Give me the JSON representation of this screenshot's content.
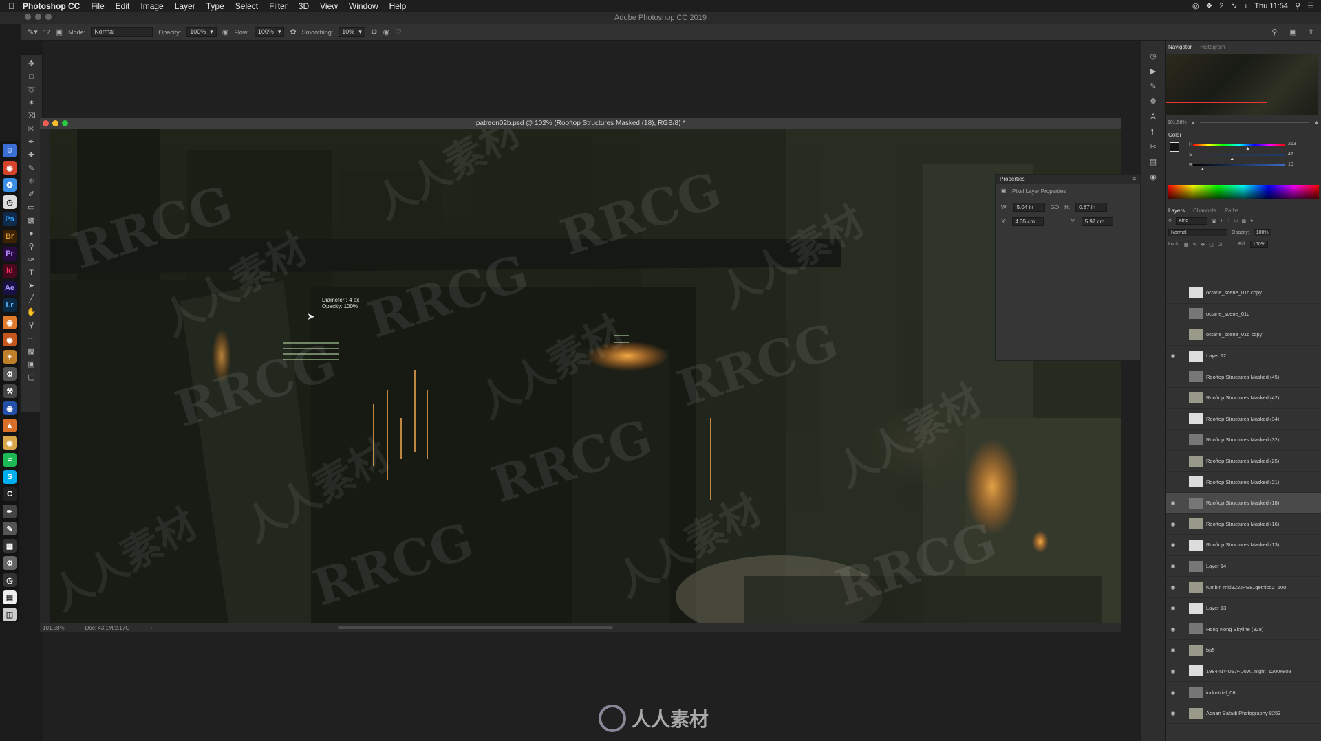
{
  "menubar": {
    "app_name": "Photoshop CC",
    "items": [
      "File",
      "Edit",
      "Image",
      "Layer",
      "Type",
      "Select",
      "Filter",
      "3D",
      "View",
      "Window",
      "Help"
    ],
    "clock": "Thu 11:54",
    "status_badge": "2"
  },
  "window_title": "Adobe Photoshop CC 2019",
  "options_bar": {
    "brush_size": "17",
    "mode_label": "Mode:",
    "mode_value": "Normal",
    "opacity_label": "Opacity:",
    "opacity_value": "100%",
    "flow_label": "Flow:",
    "flow_value": "100%",
    "smoothing_label": "Smoothing:",
    "smoothing_value": "10%"
  },
  "document": {
    "title": "patreon02b.psd @ 102% (Rooftop Structures Masked (18), RGB/8) *",
    "zoom": "101.58%",
    "doc_size": "Doc: 43.1M/2.17G"
  },
  "brush_tooltip": {
    "diameter": "Diameter :  4 px",
    "opacity": "Opacity: 100%"
  },
  "properties": {
    "title": "Properties",
    "subtitle": "Pixel Layer Properties",
    "w_label": "W:",
    "w_value": "5.04 in",
    "link_label": "GO",
    "h_label": "H:",
    "h_value": "0.87 in",
    "x_label": "X:",
    "x_value": "4.35 cm",
    "y_label": "Y:",
    "y_value": "5.97 cm"
  },
  "navigator": {
    "tabs": [
      "Navigator",
      "Histogram"
    ],
    "zoom": "101.58%"
  },
  "color": {
    "title": "Color",
    "h_label": "H",
    "h_value": "213",
    "s_label": "S",
    "s_value": "42",
    "b_label": "B",
    "b_value": "10",
    "h_fraction": 0.59,
    "s_fraction": 0.42,
    "b_fraction": 0.1
  },
  "layers_panel": {
    "tabs": [
      "Layers",
      "Channels",
      "Paths"
    ],
    "filter_label": "Kind",
    "blend_mode": "Normal",
    "opacity_label": "Opacity:",
    "opacity_value": "100%",
    "lock_label": "Lock:",
    "fill_label": "Fill:",
    "fill_value": "100%",
    "layers": [
      {
        "name": "octane_scene_01c copy",
        "visible": false,
        "selected": false
      },
      {
        "name": "octane_scene_01d",
        "visible": false,
        "selected": false
      },
      {
        "name": "octane_scene_01d copy",
        "visible": false,
        "selected": false
      },
      {
        "name": "Layer 12",
        "visible": true,
        "selected": false
      },
      {
        "name": "Rooftop Structures Masked (45)",
        "visible": false,
        "selected": false
      },
      {
        "name": "Rooftop Structures Masked (42)",
        "visible": false,
        "selected": false
      },
      {
        "name": "Rooftop Structures Masked (34)",
        "visible": false,
        "selected": false
      },
      {
        "name": "Rooftop Structures Masked (32)",
        "visible": false,
        "selected": false
      },
      {
        "name": "Rooftop Structures Masked (25)",
        "visible": false,
        "selected": false
      },
      {
        "name": "Rooftop Structures Masked (21)",
        "visible": false,
        "selected": false
      },
      {
        "name": "Rooftop Structures Masked (18)",
        "visible": true,
        "selected": true
      },
      {
        "name": "Rooftop Structures Masked (16)",
        "visible": true,
        "selected": false
      },
      {
        "name": "Rooftop Structures Masked (13)",
        "visible": true,
        "selected": false
      },
      {
        "name": "Layer 14",
        "visible": true,
        "selected": false
      },
      {
        "name": "tumblr_mkl922JPE81qetnlco2_500",
        "visible": true,
        "selected": false
      },
      {
        "name": "Layer 13",
        "visible": true,
        "selected": false
      },
      {
        "name": "Hong Kong Skyline (328)",
        "visible": true,
        "selected": false
      },
      {
        "name": "bp5",
        "visible": true,
        "selected": false
      },
      {
        "name": "1984-NY-USA-Dow...night_1200x808",
        "visible": true,
        "selected": false
      },
      {
        "name": "industrial_06",
        "visible": true,
        "selected": false
      },
      {
        "name": "Adnan Safadi Photography 8253",
        "visible": true,
        "selected": false
      }
    ]
  },
  "watermarks": {
    "latin": "RRCG",
    "chinese": "人人素材",
    "bottom_logo": "人人素材"
  },
  "colors": {
    "selected_layer": "#4a4a4a",
    "navigator_frame": "#e33"
  }
}
